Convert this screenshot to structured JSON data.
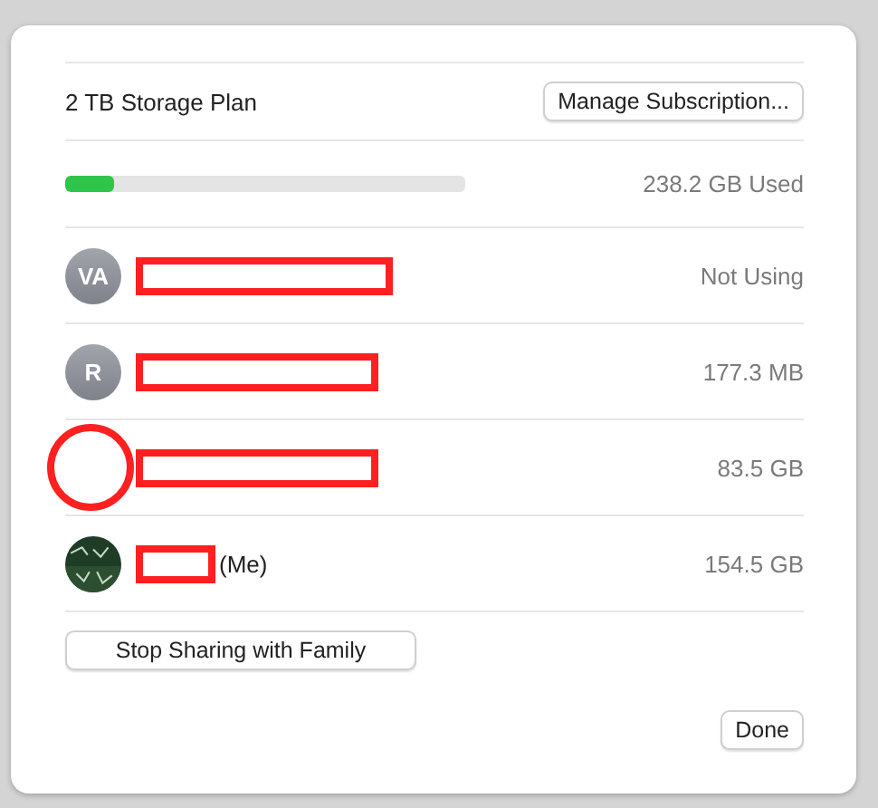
{
  "plan": {
    "label": "2 TB Storage Plan",
    "button": "Manage Subscription..."
  },
  "storage": {
    "level": 0.12,
    "reading": "238.2 GB Used"
  },
  "members": [
    {
      "avatar": {
        "kind": "initials",
        "text": "VA"
      },
      "usage": "Not Using",
      "circled": false
    },
    {
      "avatar": {
        "kind": "initials",
        "text": "R"
      },
      "usage": "177.3 MB",
      "circled": false
    },
    {
      "avatar": {
        "kind": "blank"
      },
      "usage": "83.5 GB",
      "circled": true
    },
    {
      "suffix": "(Me)",
      "usage": "154.5 GB",
      "circled": false
    }
  ],
  "stop_button": "Stop Sharing with Family",
  "done_button": "Done"
}
